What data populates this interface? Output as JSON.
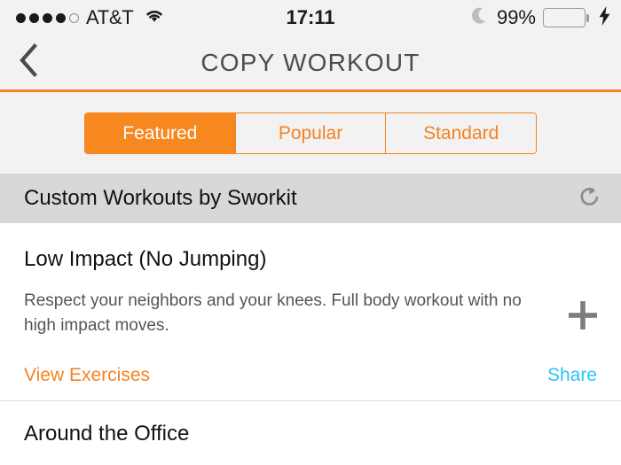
{
  "status_bar": {
    "signal_dots_filled": 4,
    "signal_dots_total": 5,
    "carrier": "AT&T",
    "wifi_icon": "wifi-icon",
    "time": "17:11",
    "do_not_disturb_icon": "moon-icon",
    "battery_percent": "99%",
    "battery_level": 99,
    "battery_charging": true,
    "battery_color": "#5ddf78",
    "charging_icon": "lightning-bolt-icon"
  },
  "navbar": {
    "back_icon": "chevron-left-icon",
    "title": "COPY WORKOUT",
    "accent_color": "#f5821f",
    "title_color": "#4d4d4d"
  },
  "segmented_control": {
    "selected_index": 0,
    "accent_color": "#f5821f",
    "segments": [
      {
        "label": "Featured",
        "selected": true
      },
      {
        "label": "Popular",
        "selected": false
      },
      {
        "label": "Standard",
        "selected": false
      }
    ]
  },
  "section_header": {
    "title": "Custom Workouts by Sworkit",
    "refresh_icon": "refresh-icon",
    "background": "#d8d8d8"
  },
  "workouts": [
    {
      "title": "Low Impact (No Jumping)",
      "description": "Respect your neighbors and your knees. Full body workout with no high impact moves.",
      "view_exercises_label": "View Exercises",
      "view_exercises_color": "#f5821f",
      "share_label": "Share",
      "share_color": "#29c5f6",
      "add_icon": "plus-icon"
    },
    {
      "title": "Around the Office"
    }
  ]
}
